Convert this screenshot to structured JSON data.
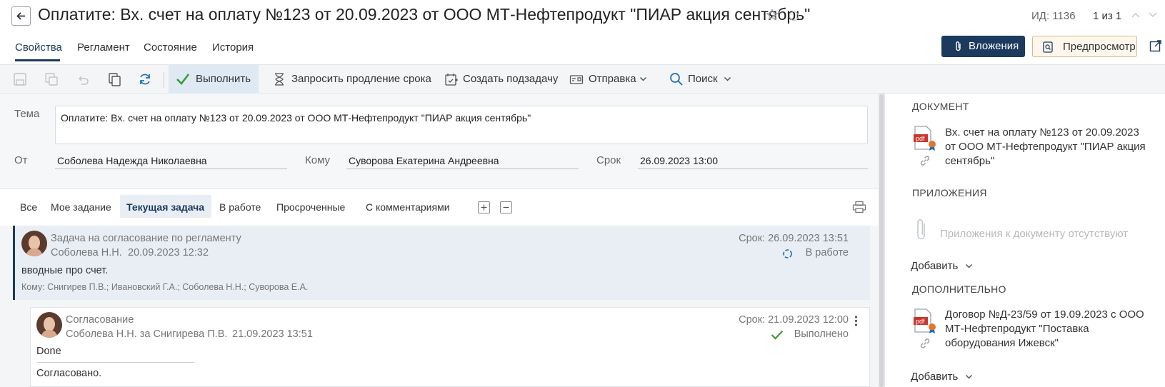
{
  "header": {
    "title": "Оплатите: Вх. счет на оплату №123 от 20.09.2023 от ООО МТ-Нефтепродукт \"ПИАР акция сентябрь\"",
    "id_label": "ИД: 1136",
    "count_label": "1 из 1",
    "tabs": [
      "Свойства",
      "Регламент",
      "Состояние",
      "История"
    ],
    "attachments_button": "Вложения",
    "preview_button": "Предпросмотр"
  },
  "toolbar": {
    "execute": "Выполнить",
    "request_extension": "Запросить продление срока",
    "create_subtask": "Создать подзадачу",
    "send": "Отправка",
    "search": "Поиск"
  },
  "form": {
    "subject_label": "Тема",
    "subject_value": "Оплатите: Вх. счет на оплату №123 от 20.09.2023 от ООО МТ-Нефтепродукт \"ПИАР акция сентябрь\"",
    "from_label": "От",
    "from_value": "Соболева Надежда Николаевна",
    "to_label": "Кому",
    "to_value": "Суворова Екатерина Андреевна",
    "due_label": "Срок",
    "due_value": "26.09.2023 13:00"
  },
  "filters": [
    "Все",
    "Мое задание",
    "Текущая задача",
    "В работе",
    "Просроченные",
    "С комментариями"
  ],
  "active_filter": "Текущая задача",
  "tasks": [
    {
      "title": "Задача на согласование по регламенту",
      "author": "Соболева Н.Н.",
      "date": "20.09.2023 12:32",
      "due": "Срок: 26.09.2023 13:51",
      "status": "В работе",
      "body": "вводные про счет.",
      "recipients": "Кому: Снигирев П.В.; Ивановский Г.А.; Соболева Н.Н.; Суворова Е.А."
    },
    {
      "title": "Согласование",
      "author": "Соболева Н.Н. за Снигирева П.В.",
      "date": "21.09.2023 13:51",
      "due": "Срок: 21.09.2023 12:00",
      "status": "Выполнено",
      "result": "Done",
      "comment": "Согласовано."
    }
  ],
  "right_panel": {
    "document_header": "ДОКУМЕНТ",
    "document_name": "Вх. счет на оплату №123 от 20.09.2023 от ООО МТ-Нефтепродукт \"ПИАР акция сентябрь\"",
    "attachments_header": "ПРИЛОЖЕНИЯ",
    "attachments_empty": "Приложения к документу отсутствуют",
    "add_label": "Добавить",
    "additional_header": "ДОПОЛНИТЕЛЬНО",
    "additional_doc": "Договор №Д-23/59 от 19.09.2023 с ООО МТ-Нефтепродукт \"Поставка оборудования Ижевск\"",
    "add_label_2": "Добавить",
    "pdf_badge": "pdf"
  },
  "colors": {
    "accent": "#1b3a5e",
    "success": "#3f9b3a",
    "pdf_red": "#c8372d"
  }
}
